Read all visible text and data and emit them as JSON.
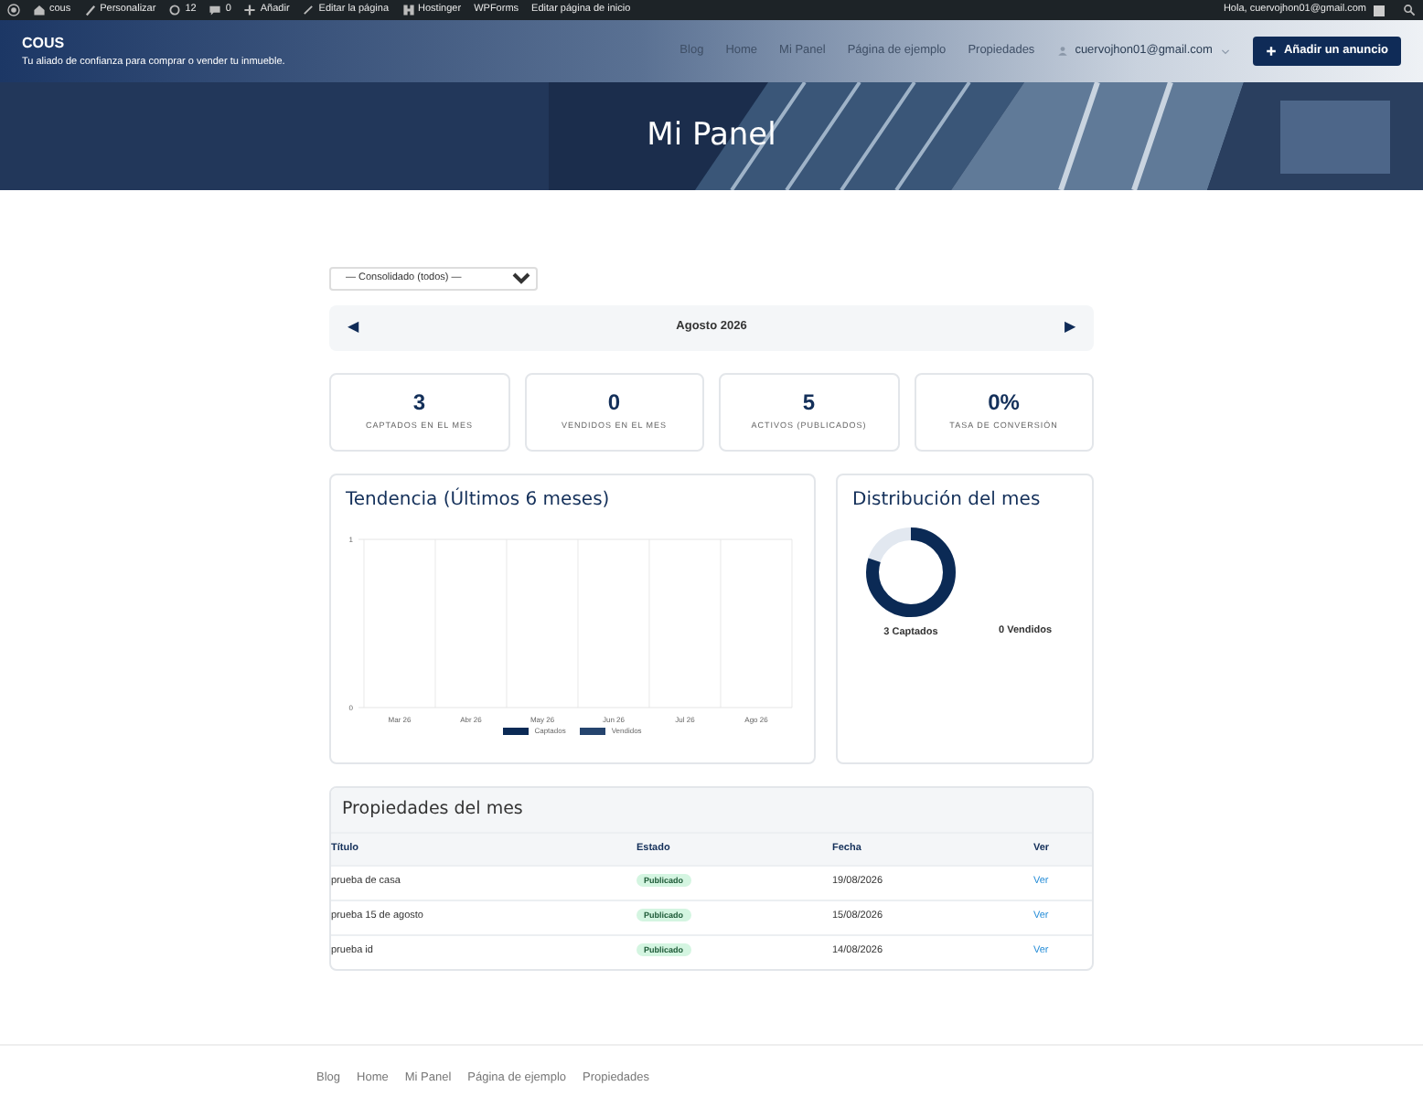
{
  "admin_bar": {
    "items": [
      {
        "kind": "wp"
      },
      {
        "kind": "home",
        "label": "cous"
      },
      {
        "kind": "brush",
        "label": "Personalizar"
      },
      {
        "kind": "refresh",
        "label": "12"
      },
      {
        "kind": "comment",
        "label": "0"
      },
      {
        "kind": "plus",
        "label": "Añadir"
      },
      {
        "kind": "pencil",
        "label": "Editar la página"
      },
      {
        "kind": "hostinger",
        "label": "Hostinger"
      },
      {
        "kind": "text",
        "label": "WPForms"
      },
      {
        "kind": "text",
        "label": "Editar página de inicio"
      }
    ],
    "greeting": "Hola, cuervojhon01@gmail.com"
  },
  "header": {
    "site_title": "COUS",
    "tagline": "Tu aliado de confianza para comprar o vender tu inmueble.",
    "nav": [
      "Blog",
      "Home",
      "Mi Panel",
      "Página de ejemplo",
      "Propiedades"
    ],
    "user": "cuervojhon01@gmail.com",
    "cta": "Añadir un anuncio"
  },
  "hero": {
    "title": "Mi Panel",
    "kind": "picture"
  },
  "filter": {
    "value": "— Consolidado (todos) —"
  },
  "month_nav": {
    "prev": "◀",
    "label": "Agosto 2026",
    "next": "▶"
  },
  "stats": [
    {
      "value": "3",
      "label": "CAPTADOS EN EL MES"
    },
    {
      "value": "0",
      "label": "VENDIDOS EN EL MES"
    },
    {
      "value": "5",
      "label": "ACTIVOS (PUBLICADOS)"
    },
    {
      "value": "0%",
      "label": "TASA DE CONVERSIÓN"
    }
  ],
  "trend": {
    "title": "Tendencia (Últimos 6 meses)",
    "chart_data": {
      "type": "bar",
      "categories": [
        "Mar 26",
        "Abr 26",
        "May 26",
        "Jun 26",
        "Jul 26",
        "Ago 26"
      ],
      "ylim": [
        0,
        1
      ],
      "yticks": [
        0,
        1
      ],
      "series": [
        {
          "name": "Captados",
          "color": "#0b2a55",
          "values": [
            0,
            0,
            0,
            0,
            0,
            0
          ]
        },
        {
          "name": "Vendidos",
          "color": "#25446e",
          "values": [
            0,
            0,
            0,
            0,
            0,
            0
          ]
        }
      ]
    }
  },
  "distribution": {
    "title": "Distribución del mes",
    "level": 0.8,
    "labels": [
      "3 Captados",
      "0 Vendidos"
    ]
  },
  "properties": {
    "title": "Propiedades del mes",
    "columns": [
      "Título",
      "Estado",
      "Fecha",
      "Ver"
    ],
    "rows": [
      {
        "title": "prueba de casa",
        "status": "Publicado",
        "date": "19/08/2026",
        "link": "Ver"
      },
      {
        "title": "prueba 15 de agosto",
        "status": "Publicado",
        "date": "15/08/2026",
        "link": "Ver"
      },
      {
        "title": "prueba id",
        "status": "Publicado",
        "date": "14/08/2026",
        "link": "Ver"
      }
    ]
  },
  "footer": {
    "nav": [
      "Blog",
      "Home",
      "Mi Panel",
      "Página de ejemplo",
      "Propiedades"
    ]
  }
}
